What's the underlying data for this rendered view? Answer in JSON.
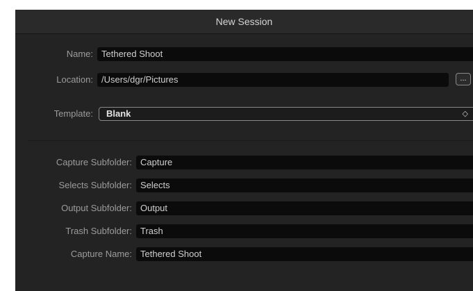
{
  "window": {
    "title": "New Session"
  },
  "session": {
    "name_label": "Name:",
    "name_value": "Tethered Shoot",
    "location_label": "Location:",
    "location_value": "/Users/dgr/Pictures",
    "browse_label": "...",
    "template_label": "Template:",
    "template_value": "Blank",
    "template_arrows": "◇"
  },
  "subfolders": {
    "capture_label": "Capture Subfolder:",
    "capture_value": "Capture",
    "selects_label": "Selects Subfolder:",
    "selects_value": "Selects",
    "output_label": "Output Subfolder:",
    "output_value": "Output",
    "trash_label": "Trash Subfolder:",
    "trash_value": "Trash",
    "capture_name_label": "Capture Name:",
    "capture_name_value": "Tethered Shoot"
  }
}
